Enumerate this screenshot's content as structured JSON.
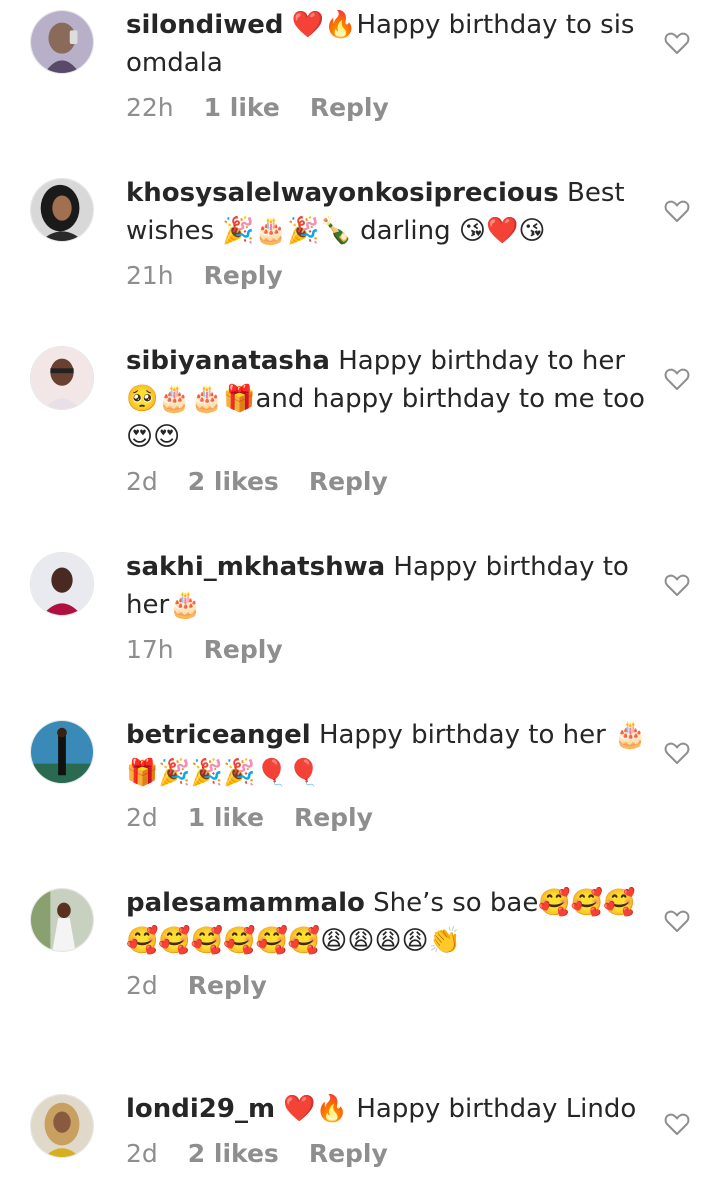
{
  "comments": [
    {
      "username": "silondiwed",
      "text": "❤️🔥Happy birthday to sis omdala",
      "time": "22h",
      "likes": "1 like",
      "reply": "Reply"
    },
    {
      "username": "khosysalelwayonkosiprecious",
      "text": "Best wishes 🎉🎂🎉🍾 darling 😘❤️😘",
      "time": "21h",
      "likes": "",
      "reply": "Reply"
    },
    {
      "username": "sibiyanatasha",
      "text": "Happy birthday to her 🥺🎂🎂🎁and happy birthday to me too 😍😍",
      "time": "2d",
      "likes": "2 likes",
      "reply": "Reply"
    },
    {
      "username": "sakhi_mkhatshwa",
      "text": "Happy birthday to her🎂",
      "time": "17h",
      "likes": "",
      "reply": "Reply"
    },
    {
      "username": "betriceangel",
      "text": "Happy birthday to her 🎂🎁🎉🎉🎉🎈🎈",
      "time": "2d",
      "likes": "1 like",
      "reply": "Reply"
    },
    {
      "username": "palesamammalo",
      "text": "She’s so bae🥰🥰🥰🥰🥰🥰🥰🥰🥰😩😩😩😩👏",
      "time": "2d",
      "likes": "",
      "reply": "Reply"
    },
    {
      "username": "londi29_m",
      "text": "❤️🔥 Happy birthday Lindo",
      "time": "2d",
      "likes": "2 likes",
      "reply": "Reply"
    }
  ],
  "icons": {
    "like": "heart-outline-icon"
  },
  "colors": {
    "text": "#262626",
    "meta": "#8e8e8e",
    "heart_stroke": "#8e8e8e"
  }
}
